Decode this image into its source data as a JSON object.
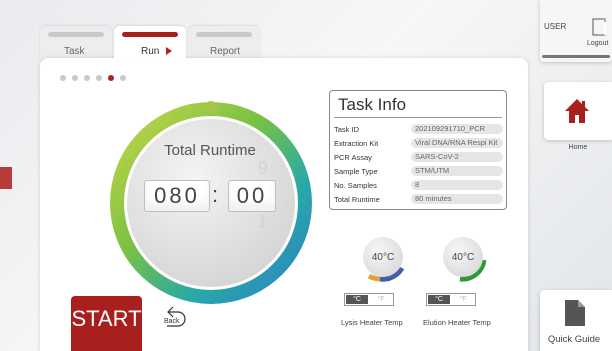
{
  "tabs": [
    {
      "label": "Task",
      "active": false
    },
    {
      "label": "Run",
      "active": true
    },
    {
      "label": "Report",
      "active": false
    }
  ],
  "progress": {
    "total_steps": 6,
    "current_step": 5
  },
  "timer": {
    "title": "Total Runtime",
    "minutes": "080",
    "seconds": "00",
    "separator": ":",
    "ghost_above": "9",
    "ghost_below": "1"
  },
  "task_info": {
    "title": "Task Info",
    "rows": [
      {
        "label": "Task ID",
        "value": "202109291710_PCR"
      },
      {
        "label": "Extraction Kit",
        "value": "Viral DNA/RNA Respi Kit"
      },
      {
        "label": "PCR Assay",
        "value": "SARS-CoV-2"
      },
      {
        "label": "Sample Type",
        "value": "STM/UTM"
      },
      {
        "label": "No. Samples",
        "value": "8"
      },
      {
        "label": "Total Runtime",
        "value": "80 minutes"
      }
    ]
  },
  "heaters": [
    {
      "temp": "40°C",
      "label": "Lysis Heater Temp",
      "unit_c": "°C",
      "unit_f": "°F",
      "accent": "#3f61a8"
    },
    {
      "temp": "40°C",
      "label": "Elution Heater Temp",
      "unit_c": "°C",
      "unit_f": "°F",
      "accent": "#2e9a3c"
    }
  ],
  "buttons": {
    "start": "START",
    "back": "Back"
  },
  "sidebar": {
    "user": "USER",
    "logout": "Logout",
    "home": "Home",
    "quick_guide": "Quick Guide"
  },
  "colors": {
    "brand_red": "#a8201e",
    "gauge_green": "#8cc63f",
    "gauge_blue": "#2f9bd5"
  }
}
